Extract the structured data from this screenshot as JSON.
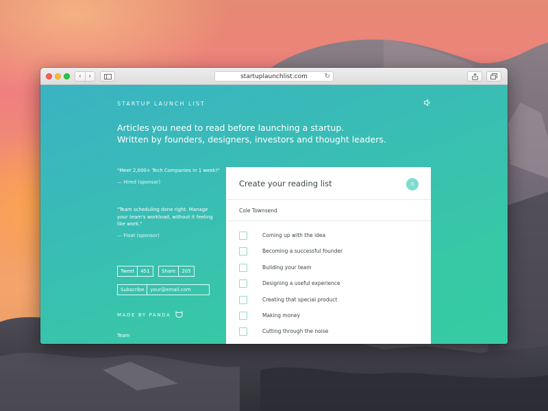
{
  "browser": {
    "url": "startuplaunchlist.com"
  },
  "site": {
    "brand": "STARTUP LAUNCH LIST",
    "headline_line1": "Articles you need to read before launching a startup.",
    "headline_line2": "Written by founders, designers, investors and thought leaders."
  },
  "sponsors": [
    {
      "quote": "\"Meet 2,000+ Tech Companies in 1 week!\"",
      "source": "— Hired (sponsor)"
    },
    {
      "quote": "\"Team scheduling done right. Manage your team's workload, without it feeling like work.\"",
      "source": "— Float (sponsor)"
    }
  ],
  "social": {
    "tweet_label": "Tweet",
    "tweet_count": "451",
    "share_label": "Share",
    "share_count": "205"
  },
  "subscribe": {
    "button_label": "Subscribe",
    "placeholder": "your@email.com"
  },
  "footer": {
    "made_by": "MADE BY PANDA",
    "team_label": "Team"
  },
  "reading_list": {
    "title": "Create your reading list",
    "count": "0",
    "author": "Cole Townsend",
    "items": [
      "Coming up with the idea",
      "Becoming a successful founder",
      "Building your team",
      "Designing a useful experience",
      "Creating that special product",
      "Making money",
      "Cutting through the noise"
    ]
  },
  "icons": {
    "sound": "speaker-icon",
    "panda": "panda-icon",
    "reload": "reload-icon",
    "share": "share-icon",
    "tabs": "tabs-icon",
    "sidebar": "sidebar-icon"
  },
  "colors": {
    "page_gradient_start": "#3ab3c3",
    "page_gradient_end": "#36cca2",
    "counter_badge": "#7fdbd0",
    "checkbox_border": "#8fd9cf"
  }
}
